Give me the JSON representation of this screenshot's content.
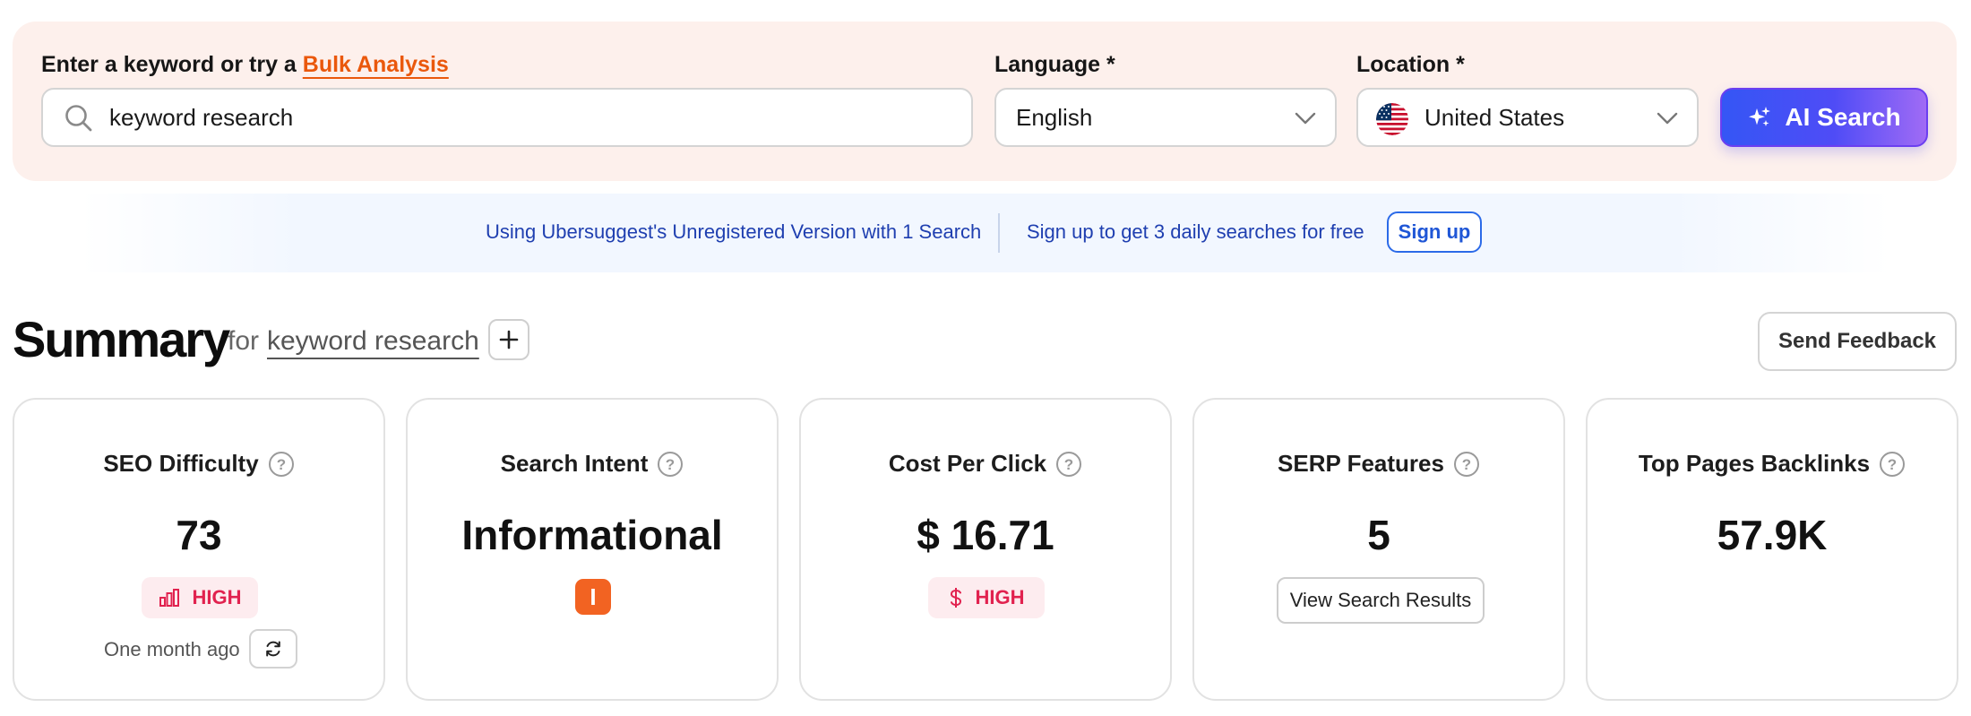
{
  "search": {
    "keyword_label_prefix": "Enter a keyword or try a",
    "bulk_link": "Bulk Analysis",
    "keyword_value": "keyword research",
    "language_label": "Language *",
    "language_value": "English",
    "location_label": "Location *",
    "location_value": "United States",
    "ai_button": "AI Search"
  },
  "banner": {
    "unregistered_text": "Using Ubersuggest's Unregistered Version with 1 Search",
    "signup_prompt": "Sign up to get 3 daily searches for free",
    "signup_button": "Sign up"
  },
  "summary": {
    "title": "Summary",
    "for_text": "for",
    "keyword": "keyword research",
    "add_button": "+",
    "feedback_button": "Send Feedback"
  },
  "cards": {
    "seo_difficulty": {
      "title": "SEO Difficulty",
      "value": "73",
      "level": "HIGH",
      "updated": "One month ago"
    },
    "search_intent": {
      "title": "Search Intent",
      "value": "Informational",
      "badge": "I"
    },
    "cpc": {
      "title": "Cost Per Click",
      "value": "$ 16.71",
      "level": "HIGH"
    },
    "serp_features": {
      "title": "SERP Features",
      "value": "5",
      "button": "View Search Results"
    },
    "backlinks": {
      "title": "Top Pages Backlinks",
      "value": "57.9K"
    }
  },
  "colors": {
    "accent_orange": "#ea580c",
    "ai_gradient_start": "#3556f5",
    "ai_gradient_end": "#a06bf5",
    "high_red": "#e1224f",
    "intent_orange": "#f26322",
    "banner_blue": "#1f3fb0"
  },
  "icons": [
    "search-icon",
    "chevron-down-icon",
    "us-flag-icon",
    "sparkle-icon",
    "plus-icon",
    "help-icon",
    "bar-chart-icon",
    "dollar-icon",
    "refresh-icon"
  ]
}
